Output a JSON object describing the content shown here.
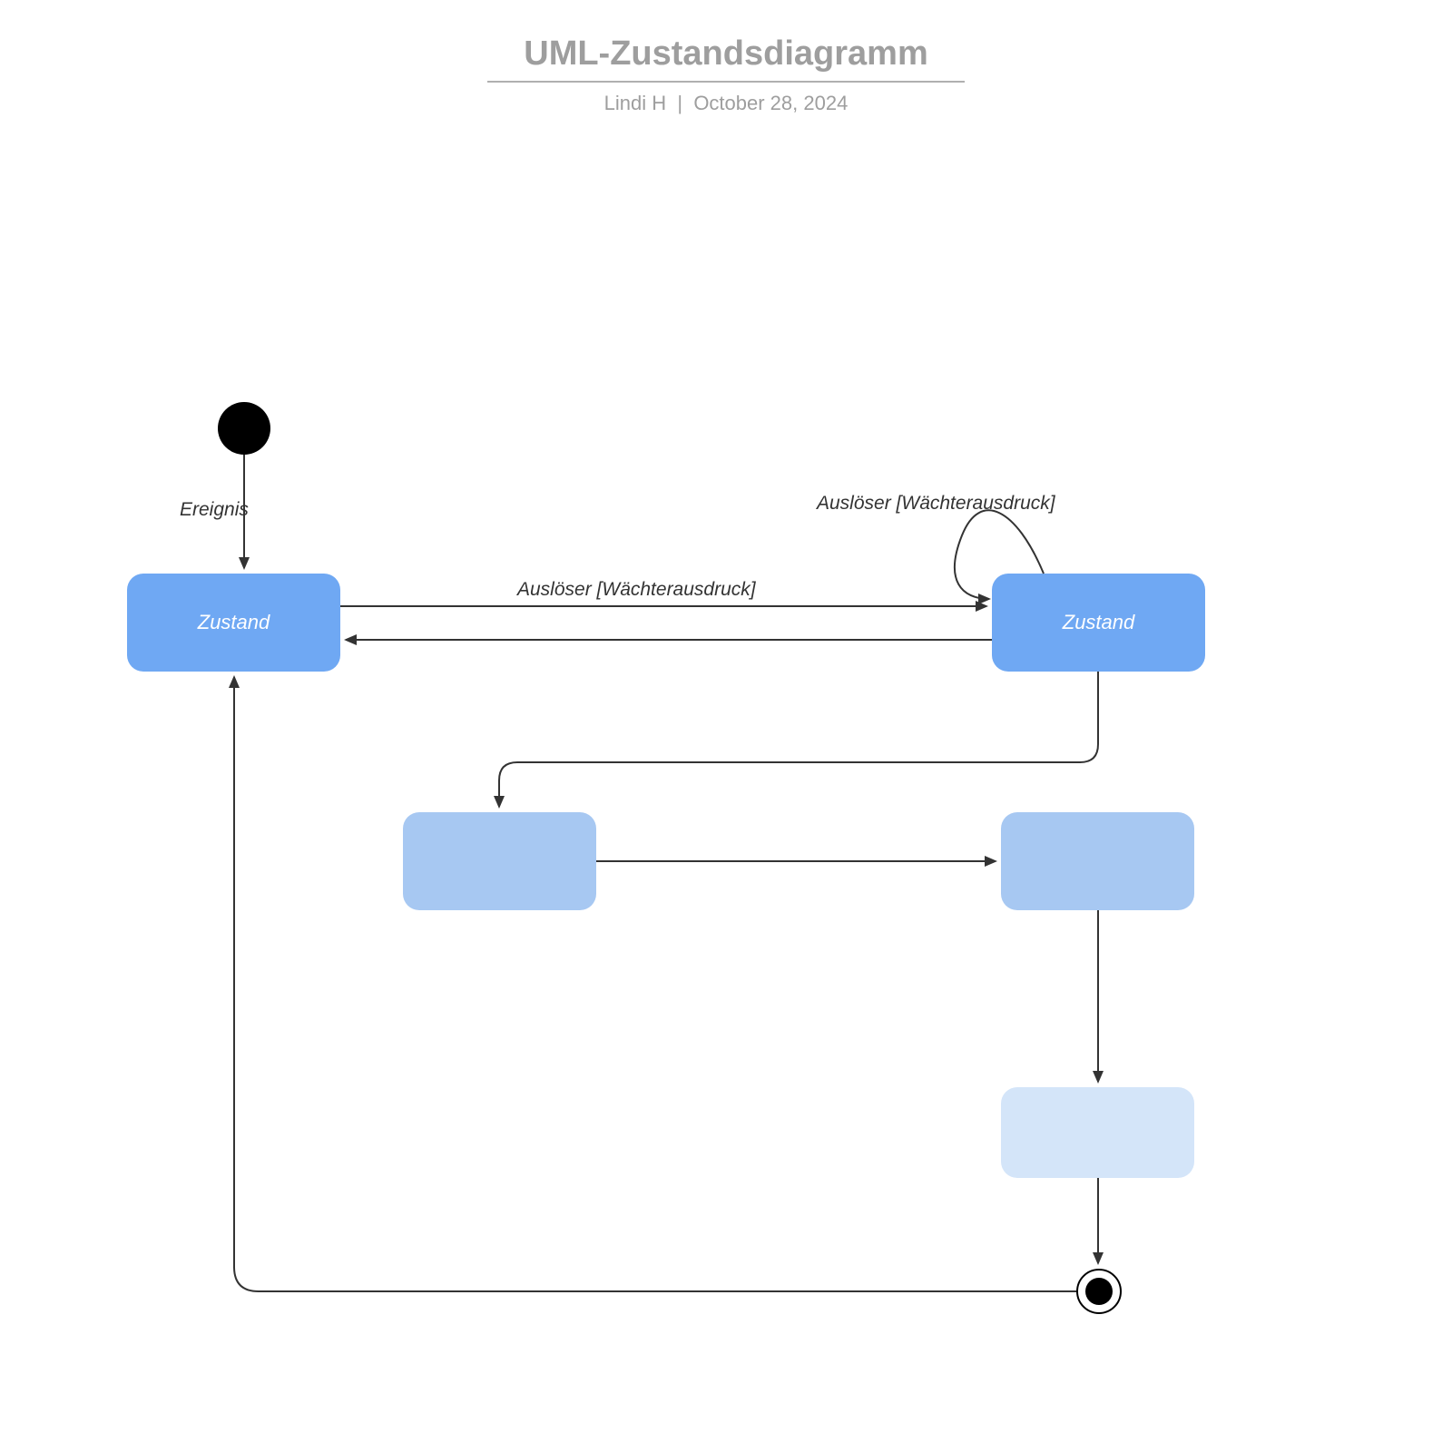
{
  "header": {
    "title": "UML-Zustandsdiagramm",
    "author": "Lindi H",
    "date": "October 28, 2024"
  },
  "nodes": {
    "state1_label": "Zustand",
    "state2_label": "Zustand",
    "state3_label": "",
    "state4_label": "",
    "state5_label": ""
  },
  "transitions": {
    "t_initial": "Ereignis",
    "t_self_loop": "Auslöser [Wächterausdruck]",
    "t_s1_s2": "Auslöser [Wächterausdruck]"
  },
  "colors": {
    "state_dark": "#6fa8f3",
    "state_mid": "#a7c8f2",
    "state_light": "#d4e5f9",
    "title_gray": "#9e9e9e"
  }
}
